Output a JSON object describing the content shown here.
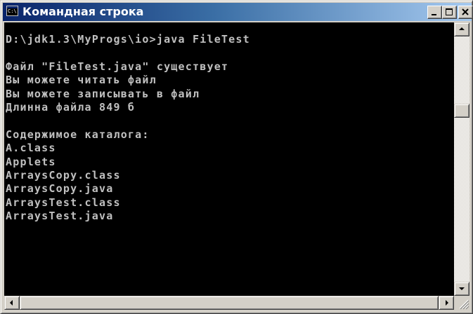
{
  "window": {
    "title": "Командная строка",
    "icon": "console-window-icon",
    "icon_glyph": "C:\\",
    "buttons": [
      "minimize-icon",
      "maximize-icon",
      "close-icon"
    ]
  },
  "console": {
    "text_color": "#c0c0c0",
    "background": "#000000",
    "lines": [
      "D:\\jdk1.3\\MyProgs\\io>java FileTest",
      "",
      "Файл \"FileTest.java\" существует",
      "Вы можете читать файл",
      "Вы можете записывать в файл",
      "Длинна файла 849 б",
      "",
      "Содержимое каталога:",
      "A.class",
      "Applets",
      "ArraysCopy.class",
      "ArraysCopy.java",
      "ArraysTest.class",
      "ArraysTest.java"
    ]
  },
  "scrollbars": {
    "vertical_position": 0.3,
    "horizontal_position": 0
  }
}
